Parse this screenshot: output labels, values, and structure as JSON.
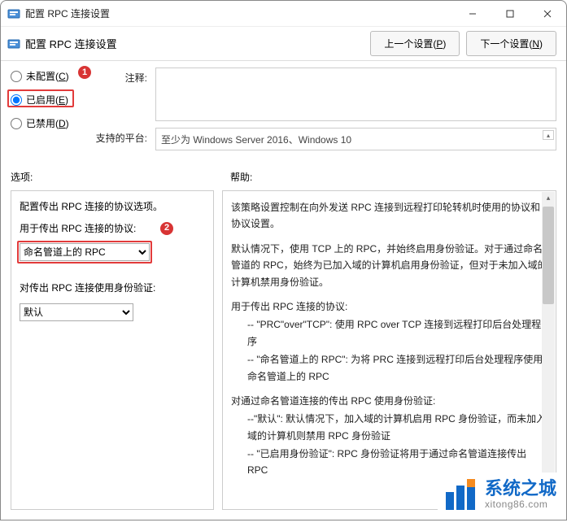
{
  "titlebar": {
    "title": "配置 RPC 连接设置"
  },
  "header": {
    "title": "配置 RPC 连接设置",
    "prev_btn": "上一个设置(",
    "prev_key": "P",
    "prev_btn_suffix": ")",
    "next_btn": "下一个设置(",
    "next_key": "N",
    "next_btn_suffix": ")"
  },
  "radios": {
    "not_configured": "未配置(",
    "not_configured_key": "C",
    "not_configured_suffix": ")",
    "enabled": "已启用(",
    "enabled_key": "E",
    "enabled_suffix": ")",
    "disabled": "已禁用(",
    "disabled_key": "D",
    "disabled_suffix": ")"
  },
  "labels": {
    "comment": "注释:",
    "platform": "支持的平台:",
    "options": "选项:",
    "help": "帮助:"
  },
  "platform_text": "至少为 Windows Server 2016、Windows 10",
  "options": {
    "line1": "配置传出 RPC 连接的协议选项。",
    "line2": "用于传出 RPC 连接的协议:",
    "protocol_selected": "命名管道上的 RPC",
    "line3": "对传出 RPC 连接使用身份验证:",
    "auth_selected": "默认"
  },
  "help": {
    "p1": "该策略设置控制在向外发送 RPC 连接到远程打印轮转机时使用的协议和协议设置。",
    "p2": "默认情况下，使用 TCP 上的 RPC，并始终启用身份验证。对于通过命名管道的 RPC，始终为已加入域的计算机启用身份验证，但对于未加入域的计算机禁用身份验证。",
    "p3_title": "用于传出 RPC 连接的协议:",
    "p3_a": "-- \"PRC\"over\"TCP\": 使用 RPC over TCP 连接到远程打印后台处理程序",
    "p3_b": "-- \"命名管道上的 RPC\": 为将 PRC 连接到远程打印后台处理程序使用命名管道上的 RPC",
    "p4_title": "对通过命名管道连接的传出 RPC 使用身份验证:",
    "p4_a": "--\"默认\": 默认情况下，加入域的计算机启用 RPC 身份验证，而未加入域的计算机则禁用 RPC 身份验证",
    "p4_b": "-- \"已启用身份验证\": RPC 身份验证将用于通过命名管道连接传出 RPC"
  },
  "badges": {
    "b1": "1",
    "b2": "2"
  },
  "watermark": {
    "line1": "系统之城",
    "line2": "xitong86.com"
  }
}
